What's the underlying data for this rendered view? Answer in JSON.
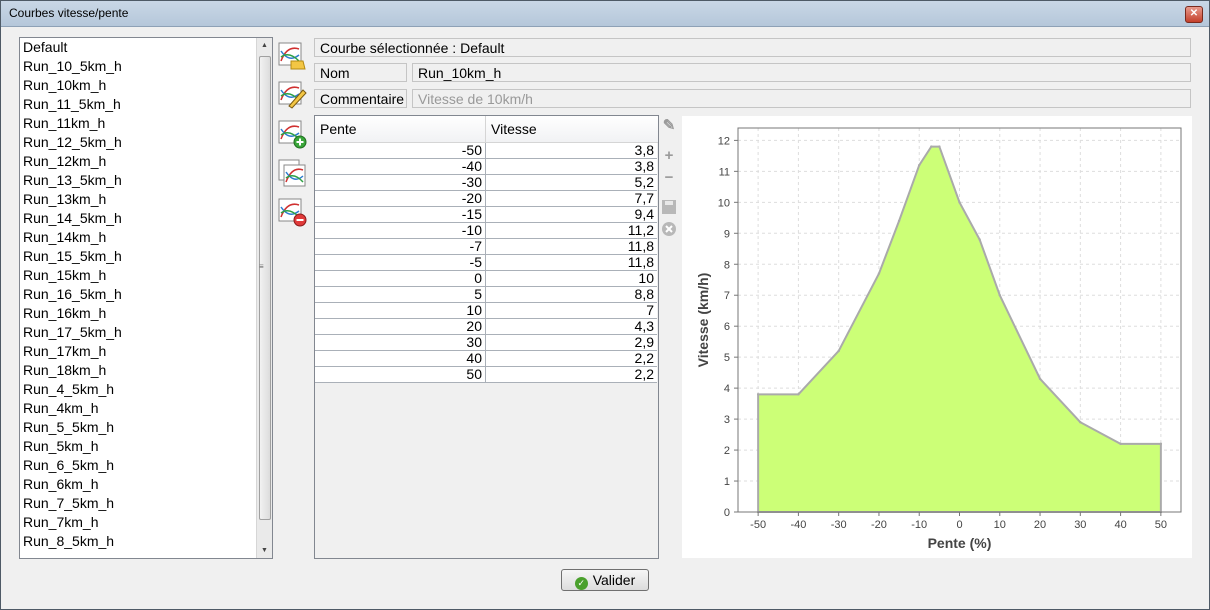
{
  "window": {
    "title": "Courbes vitesse/pente",
    "close_icon": "close-icon"
  },
  "curves": [
    "Default",
    "Run_10_5km_h",
    "Run_10km_h",
    "Run_11_5km_h",
    "Run_11km_h",
    "Run_12_5km_h",
    "Run_12km_h",
    "Run_13_5km_h",
    "Run_13km_h",
    "Run_14_5km_h",
    "Run_14km_h",
    "Run_15_5km_h",
    "Run_15km_h",
    "Run_16_5km_h",
    "Run_16km_h",
    "Run_17_5km_h",
    "Run_17km_h",
    "Run_18km_h",
    "Run_4_5km_h",
    "Run_4km_h",
    "Run_5_5km_h",
    "Run_5km_h",
    "Run_6_5km_h",
    "Run_6km_h",
    "Run_7_5km_h",
    "Run_7km_h",
    "Run_8_5km_h"
  ],
  "toolbar": {
    "icons": [
      "open-curve-icon",
      "edit-curve-icon",
      "add-curve-icon",
      "copy-curve-icon",
      "delete-curve-icon"
    ]
  },
  "selection": {
    "label": "Courbe sélectionnée : Default"
  },
  "form": {
    "name_label": "Nom",
    "name_value": "Run_10km_h",
    "comment_label": "Commentaire",
    "comment_placeholder": "Vitesse de 10km/h"
  },
  "table": {
    "headers": [
      "Pente",
      "Vitesse"
    ],
    "rows": [
      [
        "-50",
        "3,8"
      ],
      [
        "-40",
        "3,8"
      ],
      [
        "-30",
        "5,2"
      ],
      [
        "-20",
        "7,7"
      ],
      [
        "-15",
        "9,4"
      ],
      [
        "-10",
        "11,2"
      ],
      [
        "-7",
        "11,8"
      ],
      [
        "-5",
        "11,8"
      ],
      [
        "0",
        "10"
      ],
      [
        "5",
        "8,8"
      ],
      [
        "10",
        "7"
      ],
      [
        "20",
        "4,3"
      ],
      [
        "30",
        "2,9"
      ],
      [
        "40",
        "2,2"
      ],
      [
        "50",
        "2,2"
      ]
    ]
  },
  "side_tools": [
    "pencil-icon",
    "plus-icon",
    "minus-icon",
    "save-icon",
    "cancel-icon"
  ],
  "chart_data": {
    "type": "area",
    "x": [
      -50,
      -40,
      -30,
      -20,
      -15,
      -10,
      -7,
      -5,
      0,
      5,
      10,
      20,
      30,
      40,
      50
    ],
    "y": [
      3.8,
      3.8,
      5.2,
      7.7,
      9.4,
      11.2,
      11.8,
      11.8,
      10,
      8.8,
      7,
      4.3,
      2.9,
      2.2,
      2.2
    ],
    "xlabel": "Pente (%)",
    "ylabel": "Vitesse (km/h)",
    "xlim": [
      -55,
      55
    ],
    "ylim": [
      0,
      12.4
    ],
    "xticks": [
      -50,
      -40,
      -30,
      -20,
      -10,
      0,
      10,
      20,
      30,
      40,
      50
    ],
    "yticks": [
      0,
      1,
      2,
      3,
      4,
      5,
      6,
      7,
      8,
      9,
      10,
      11,
      12
    ],
    "fill_color": "#ccff77",
    "line_color": "#aaaaaa",
    "grid": true
  },
  "footer": {
    "ok_label": "Valider"
  }
}
